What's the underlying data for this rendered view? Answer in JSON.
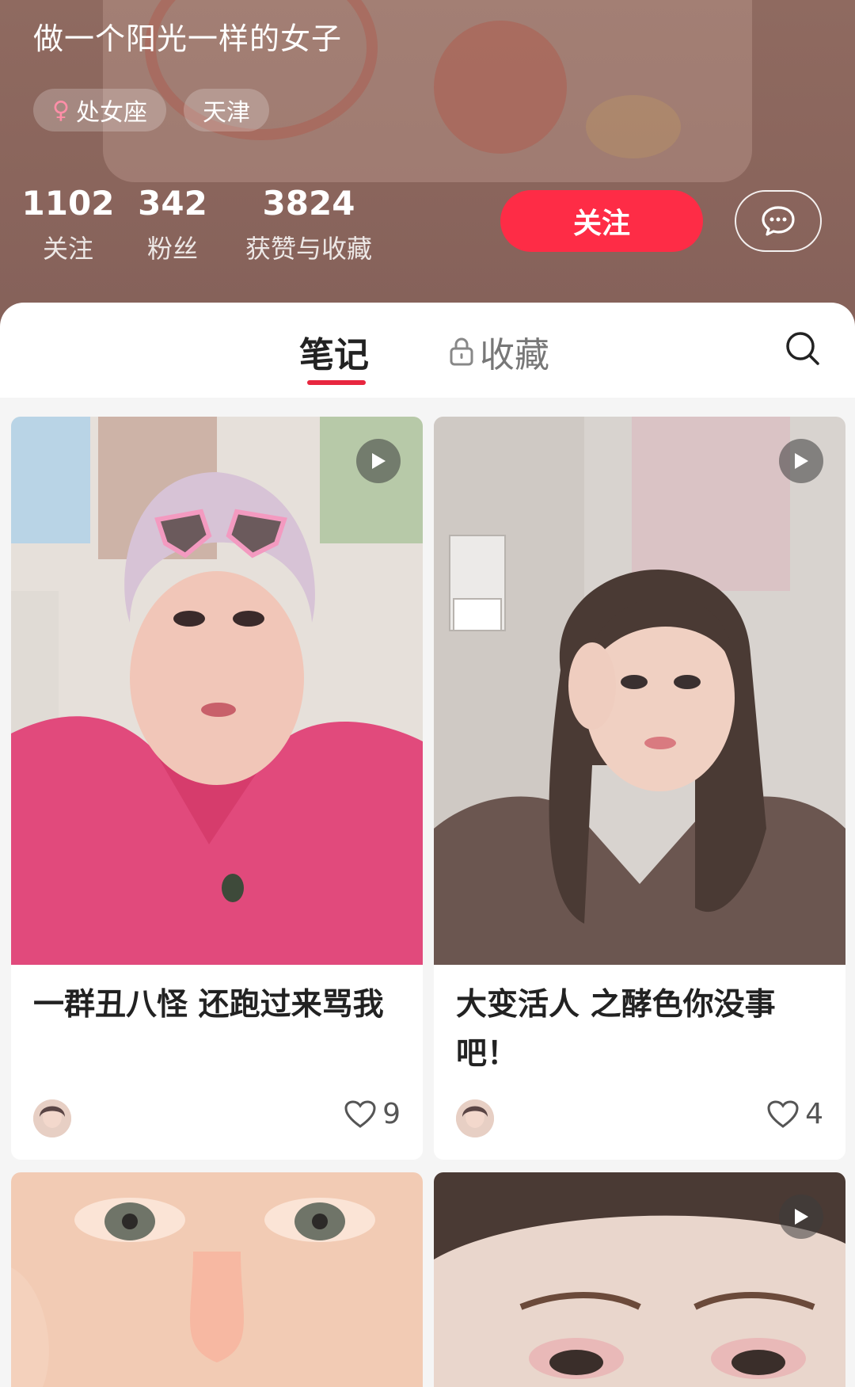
{
  "profile": {
    "bio": "做一个阳光一样的女子",
    "tags": [
      {
        "icon": "female-icon",
        "label": "处女座"
      },
      {
        "label": "天津"
      }
    ],
    "stats": [
      {
        "value": "1102",
        "label": "关注"
      },
      {
        "value": "342",
        "label": "粉丝"
      },
      {
        "value": "3824",
        "label": "获赞与收藏"
      }
    ],
    "follow_label": "关注",
    "chat_icon": "chat-bubble-icon"
  },
  "tabs": {
    "notes_label": "笔记",
    "favorites_label": "收藏",
    "favorites_icon": "lock-icon",
    "search_icon": "search-icon"
  },
  "feed": [
    {
      "title": "一群丑八怪 还跑过来骂我",
      "likes": "9",
      "video": true
    },
    {
      "title": "大变活人 之酵色你没事吧！",
      "likes": "4",
      "video": true
    },
    {
      "title": "",
      "likes": "",
      "video": false
    },
    {
      "title": "",
      "likes": "",
      "video": true
    }
  ],
  "colors": {
    "accent": "#fe2c46",
    "header_bg": "#8a655c"
  }
}
